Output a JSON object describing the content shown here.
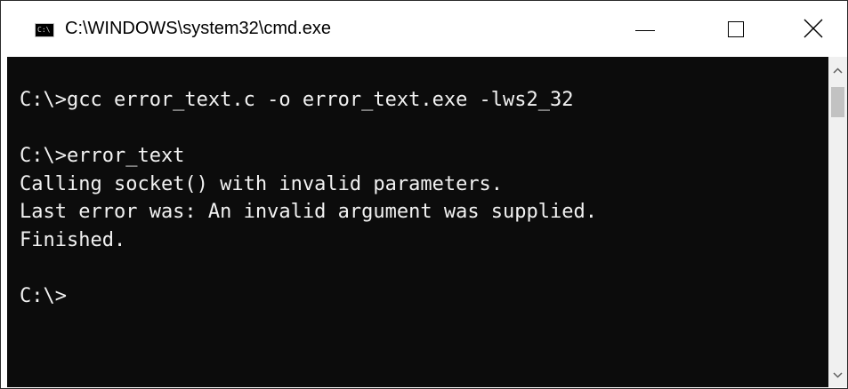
{
  "window": {
    "title": "C:\\WINDOWS\\system32\\cmd.exe",
    "icon": "cmd-console-icon",
    "icon_text": "C:\\",
    "controls": {
      "minimize_icon": "minimize-icon",
      "maximize_icon": "maximize-icon",
      "close_icon": "close-icon"
    }
  },
  "console": {
    "background": "#0c0c0c",
    "foreground": "#f2f2f2",
    "lines": [
      "C:\\>gcc error_text.c -o error_text.exe -lws2_32",
      "",
      "C:\\>error_text",
      "Calling socket() with invalid parameters.",
      "Last error was: An invalid argument was supplied.",
      "Finished.",
      "",
      "C:\\>"
    ]
  },
  "scrollbar": {
    "up_icon": "scroll-up-arrow-icon",
    "down_icon": "scroll-down-arrow-icon",
    "position_fraction": 0.0
  }
}
